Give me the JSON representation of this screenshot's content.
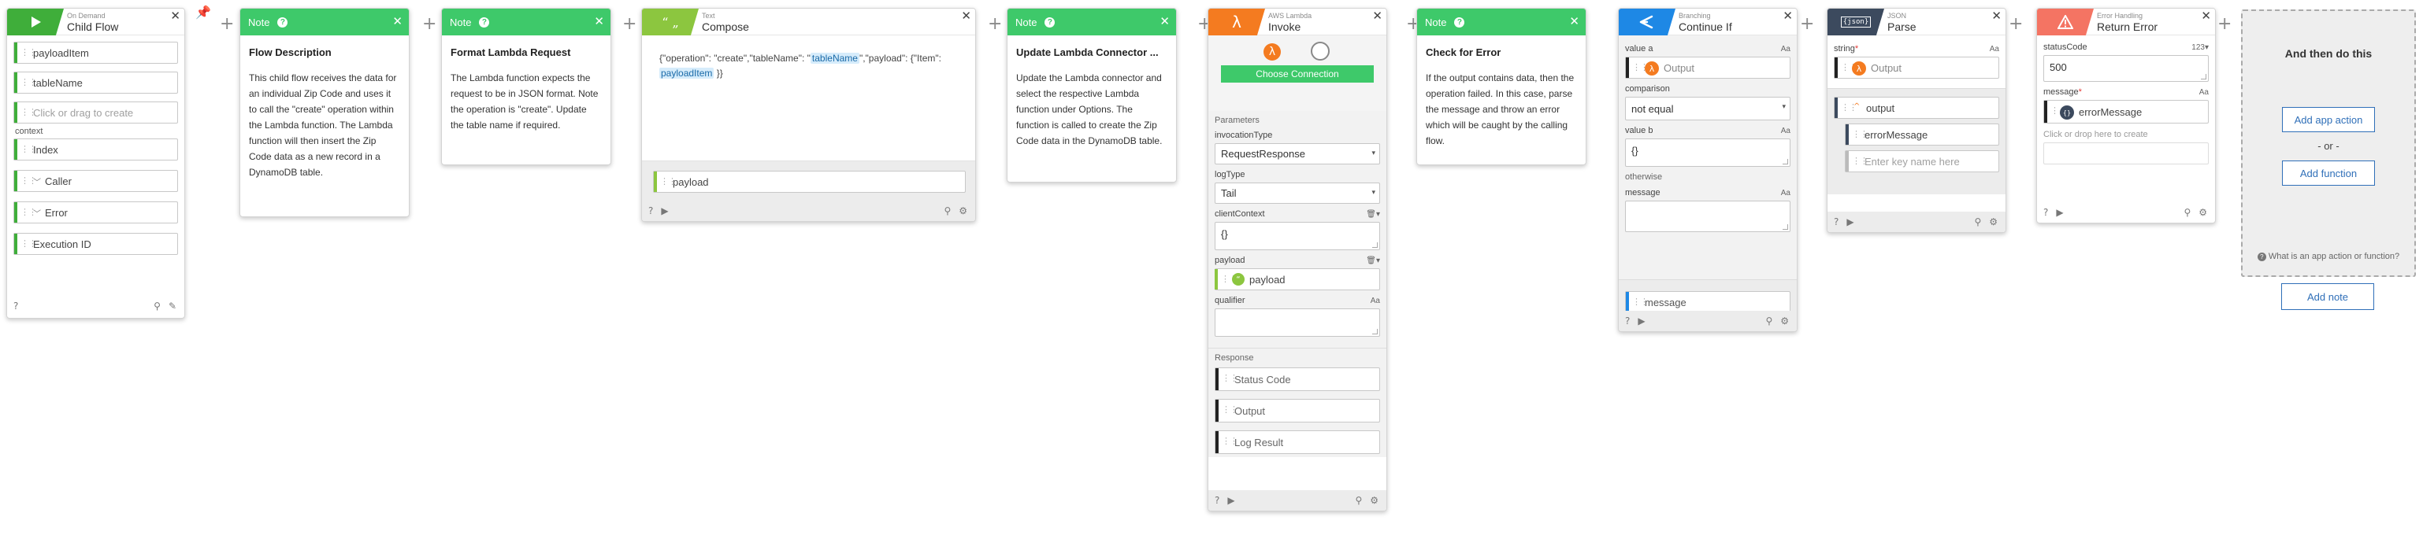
{
  "trigger": {
    "small": "On Demand",
    "title": "Child Flow",
    "fields": [
      "payloadItem",
      "tableName"
    ],
    "placeholder": "Click or drag to create",
    "context_label": "context",
    "context_fields": [
      "Index",
      "Caller",
      "Error",
      "Execution ID"
    ]
  },
  "note1": {
    "label": "Note",
    "title": "Flow Description",
    "text": "This child flow receives the data for an individual Zip Code and uses it to call the \"create\" operation within the Lambda function. The Lambda function will then insert the Zip Code data as a new record in a DynamoDB table."
  },
  "note2": {
    "label": "Note",
    "title": "Format Lambda Request",
    "text": "The Lambda function expects the request to be in JSON format. Note the operation is \"create\". Update the table name if required."
  },
  "compose": {
    "small": "Text",
    "title": "Compose",
    "text_a": "{\"operation\": \"create\",\"tableName\": \"",
    "token_a": "tableName",
    "text_b": "\",\"payload\": {\"Item\": ",
    "token_b": "payloadItem",
    "text_c": " }}",
    "output": "payload"
  },
  "note3": {
    "label": "Note",
    "title": "Update Lambda Connector ...",
    "text": "Update the Lambda connector and select the respective Lambda function under Options. The function is called to create the Zip Code data in the DynamoDB table."
  },
  "lambda": {
    "small": "AWS Lambda",
    "title": "Invoke",
    "choose": "Choose Connection",
    "params_label": "Parameters",
    "inv_label": "invocationType",
    "inv_value": "RequestResponse",
    "log_label": "logType",
    "log_value": "Tail",
    "ctx_label": "clientContext",
    "ctx_value": "{}",
    "payload_label": "payload",
    "payload_value": "payload",
    "qual_label": "qualifier",
    "aa": "Aa",
    "response_label": "Response",
    "response_fields": [
      "Status Code",
      "Output",
      "Log Result"
    ]
  },
  "note4": {
    "label": "Note",
    "title": "Check for Error",
    "text": "If the output contains data, then the operation failed. In this case, parse the message and throw an error which will be caught by the calling flow."
  },
  "cont": {
    "small": "Branching",
    "title": "Continue If",
    "value_a_label": "value a",
    "value_a": "Output",
    "comparison_label": "comparison",
    "comparison": "not equal",
    "value_b_label": "value b",
    "value_b": "{}",
    "otherwise_label": "otherwise",
    "message_label": "message",
    "aa": "Aa",
    "output": "message"
  },
  "parse": {
    "small": "JSON",
    "title": "Parse",
    "string_label": "string",
    "aa": "Aa",
    "string_value": "Output",
    "output_root": "output",
    "output_child": "errorMessage",
    "key_placeholder": "Enter key name here",
    "icon_text": "{json}"
  },
  "err": {
    "small": "Error Handling",
    "title": "Return Error",
    "status_label": "statusCode",
    "status_type": "123",
    "status_value": "500",
    "message_label": "message",
    "aa": "Aa",
    "message_value": "errorMessage",
    "drop_hint": "Click or drop here to create"
  },
  "panel": {
    "title": "And then do this",
    "add_action": "Add app action",
    "or": "- or -",
    "add_function": "Add function",
    "question": "What is an app action or function?",
    "add_note": "Add note"
  },
  "colors": {
    "trigger": "#3fae3a",
    "note": "#3ec96a",
    "compose": "#8cc63f",
    "lambda": "#f47b20",
    "continue": "#1e88e5",
    "json": "#3c4a5e",
    "error": "#f47463",
    "link": "#2f6fb8"
  }
}
